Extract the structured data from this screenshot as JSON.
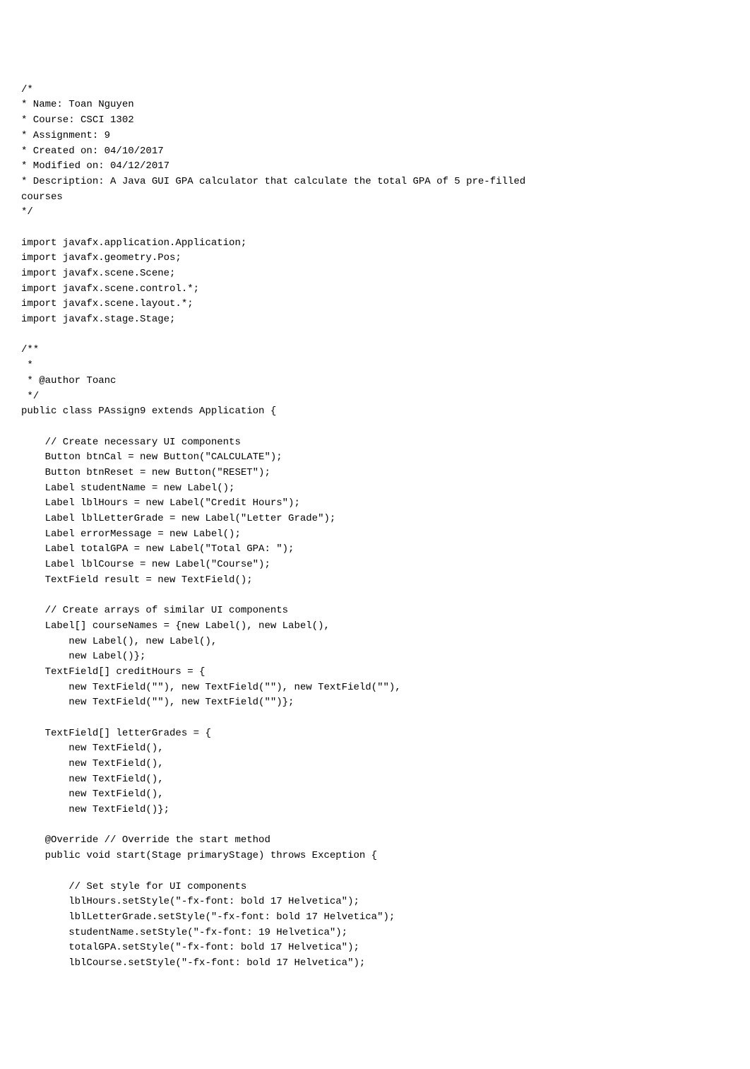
{
  "code": {
    "lines": [
      "/*",
      "* Name: Toan Nguyen",
      "* Course: CSCI 1302",
      "* Assignment: 9",
      "* Created on: 04/10/2017",
      "* Modified on: 04/12/2017",
      "* Description: A Java GUI GPA calculator that calculate the total GPA of 5 pre-filled",
      "courses",
      "*/",
      "",
      "import javafx.application.Application;",
      "import javafx.geometry.Pos;",
      "import javafx.scene.Scene;",
      "import javafx.scene.control.*;",
      "import javafx.scene.layout.*;",
      "import javafx.stage.Stage;",
      "",
      "/**",
      " *",
      " * @author Toanc",
      " */",
      "public class PAssign9 extends Application {",
      "",
      "    // Create necessary UI components",
      "    Button btnCal = new Button(\"CALCULATE\");",
      "    Button btnReset = new Button(\"RESET\");",
      "    Label studentName = new Label();",
      "    Label lblHours = new Label(\"Credit Hours\");",
      "    Label lblLetterGrade = new Label(\"Letter Grade\");",
      "    Label errorMessage = new Label();",
      "    Label totalGPA = new Label(\"Total GPA: \");",
      "    Label lblCourse = new Label(\"Course\");",
      "    TextField result = new TextField();",
      "",
      "    // Create arrays of similar UI components",
      "    Label[] courseNames = {new Label(), new Label(),",
      "        new Label(), new Label(),",
      "        new Label()};",
      "    TextField[] creditHours = {",
      "        new TextField(\"\"), new TextField(\"\"), new TextField(\"\"),",
      "        new TextField(\"\"), new TextField(\"\")};",
      "",
      "    TextField[] letterGrades = {",
      "        new TextField(),",
      "        new TextField(),",
      "        new TextField(),",
      "        new TextField(),",
      "        new TextField()};",
      "",
      "    @Override // Override the start method",
      "    public void start(Stage primaryStage) throws Exception {",
      "",
      "        // Set style for UI components",
      "        lblHours.setStyle(\"-fx-font: bold 17 Helvetica\");",
      "        lblLetterGrade.setStyle(\"-fx-font: bold 17 Helvetica\");",
      "        studentName.setStyle(\"-fx-font: 19 Helvetica\");",
      "        totalGPA.setStyle(\"-fx-font: bold 17 Helvetica\");",
      "        lblCourse.setStyle(\"-fx-font: bold 17 Helvetica\");"
    ]
  }
}
